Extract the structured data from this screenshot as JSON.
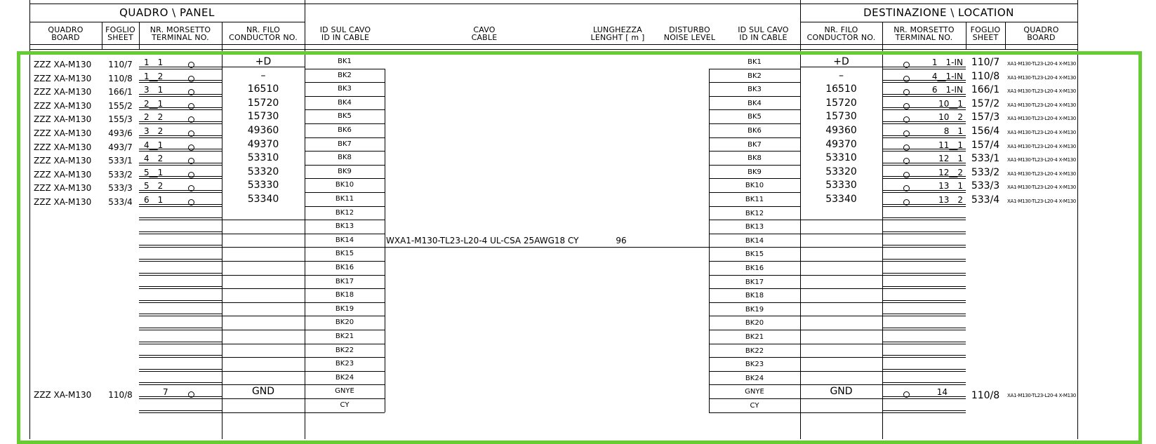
{
  "headers": {
    "panel_group": "QUADRO \\ PANEL",
    "destination_group": "DESTINAZIONE \\ LOCATION",
    "left": [
      {
        "l1": "QUADRO",
        "l2": "BOARD"
      },
      {
        "l1": "FOGLIO",
        "l2": "SHEET"
      },
      {
        "l1": "NR. MORSETTO",
        "l2": "TERMINAL NO."
      },
      {
        "l1": "NR. FILO",
        "l2": "CONDUCTOR NO."
      }
    ],
    "middle": [
      {
        "l1": "ID SUL CAVO",
        "l2": "ID IN CABLE"
      },
      {
        "l1": "CAVO",
        "l2": "CABLE"
      },
      {
        "l1": "LUNGHEZZA",
        "l2": "LENGHT [ m ]"
      },
      {
        "l1": "DISTURBO",
        "l2": "NOISE LEVEL"
      },
      {
        "l1": "ID SUL CAVO",
        "l2": "ID IN CABLE"
      }
    ],
    "right": [
      {
        "l1": "NR. FILO",
        "l2": "CONDUCTOR NO."
      },
      {
        "l1": "NR. MORSETTO",
        "l2": "TERMINAL NO."
      },
      {
        "l1": "FOGLIO",
        "l2": "SHEET"
      },
      {
        "l1": "QUADRO",
        "l2": "BOARD"
      }
    ]
  },
  "cable": {
    "name": "WXA1-M130-TL23-L20-4  UL-CSA 25AWG18 CY",
    "length": "96",
    "noise_level": ""
  },
  "cable_ids": [
    "BK1",
    "BK2",
    "BK3",
    "BK4",
    "BK5",
    "BK6",
    "BK7",
    "BK8",
    "BK9",
    "BK10",
    "BK11",
    "BK12",
    "BK13",
    "BK14",
    "BK15",
    "BK16",
    "BK17",
    "BK18",
    "BK19",
    "BK20",
    "BK21",
    "BK22",
    "BK23",
    "BK24",
    "GNYE",
    "CY"
  ],
  "source_rows": [
    {
      "board": "ZZZ XA-M130",
      "sheet": "110/7",
      "terminal": "1__1",
      "conductor": "+D"
    },
    {
      "board": "ZZZ XA-M130",
      "sheet": "110/8",
      "terminal": "1__2",
      "conductor": "–"
    },
    {
      "board": "ZZZ XA-M130",
      "sheet": "166/1",
      "terminal": "3__1",
      "conductor": "16510"
    },
    {
      "board": "ZZZ XA-M130",
      "sheet": "155/2",
      "terminal": "2__1",
      "conductor": "15720"
    },
    {
      "board": "ZZZ XA-M130",
      "sheet": "155/3",
      "terminal": "2__2",
      "conductor": "15730"
    },
    {
      "board": "ZZZ XA-M130",
      "sheet": "493/6",
      "terminal": "3__2",
      "conductor": "49360"
    },
    {
      "board": "ZZZ XA-M130",
      "sheet": "493/7",
      "terminal": "4__1",
      "conductor": "49370"
    },
    {
      "board": "ZZZ XA-M130",
      "sheet": "533/1",
      "terminal": "4__2",
      "conductor": "53310"
    },
    {
      "board": "ZZZ XA-M130",
      "sheet": "533/2",
      "terminal": "5__1",
      "conductor": "53320"
    },
    {
      "board": "ZZZ XA-M130",
      "sheet": "533/3",
      "terminal": "5__2",
      "conductor": "53330"
    },
    {
      "board": "ZZZ XA-M130",
      "sheet": "533/4",
      "terminal": "6__1",
      "conductor": "53340"
    }
  ],
  "source_ground": {
    "board": "ZZZ XA-M130",
    "sheet": "110/8",
    "terminal": "7",
    "conductor": "GND"
  },
  "dest_rows": [
    {
      "conductor": "+D",
      "terminal": "1__1-IN",
      "sheet": "110/7",
      "board": "XA1-M130-TL23-L20-4 X-M130"
    },
    {
      "conductor": "–",
      "terminal": "4__1-IN",
      "sheet": "110/8",
      "board": "XA1-M130-TL23-L20-4 X-M130"
    },
    {
      "conductor": "16510",
      "terminal": "6__1-IN",
      "sheet": "166/1",
      "board": "XA1-M130-TL23-L20-4 X-M130"
    },
    {
      "conductor": "15720",
      "terminal": "10__1",
      "sheet": "157/2",
      "board": "XA1-M130-TL23-L20-4 X-M130"
    },
    {
      "conductor": "15730",
      "terminal": "10__2",
      "sheet": "157/3",
      "board": "XA1-M130-TL23-L20-4 X-M130"
    },
    {
      "conductor": "49360",
      "terminal": "8__1",
      "sheet": "156/4",
      "board": "XA1-M130-TL23-L20-4 X-M130"
    },
    {
      "conductor": "49370",
      "terminal": "11__1",
      "sheet": "157/4",
      "board": "XA1-M130-TL23-L20-4 X-M130"
    },
    {
      "conductor": "53310",
      "terminal": "12__1",
      "sheet": "533/1",
      "board": "XA1-M130-TL23-L20-4 X-M130"
    },
    {
      "conductor": "53320",
      "terminal": "12__2",
      "sheet": "533/2",
      "board": "XA1-M130-TL23-L20-4 X-M130"
    },
    {
      "conductor": "53330",
      "terminal": "13__1",
      "sheet": "533/3",
      "board": "XA1-M130-TL23-L20-4 X-M130"
    },
    {
      "conductor": "53340",
      "terminal": "13__2",
      "sheet": "533/4",
      "board": "XA1-M130-TL23-L20-4 X-M130"
    }
  ],
  "dest_ground": {
    "conductor": "GND",
    "terminal": "14",
    "sheet": "110/8",
    "board": "XA1-M130-TL23-L20-4 X-M130"
  },
  "colors": {
    "ink": "#000000",
    "highlight": "#66cc33",
    "background": "#ffffff"
  }
}
